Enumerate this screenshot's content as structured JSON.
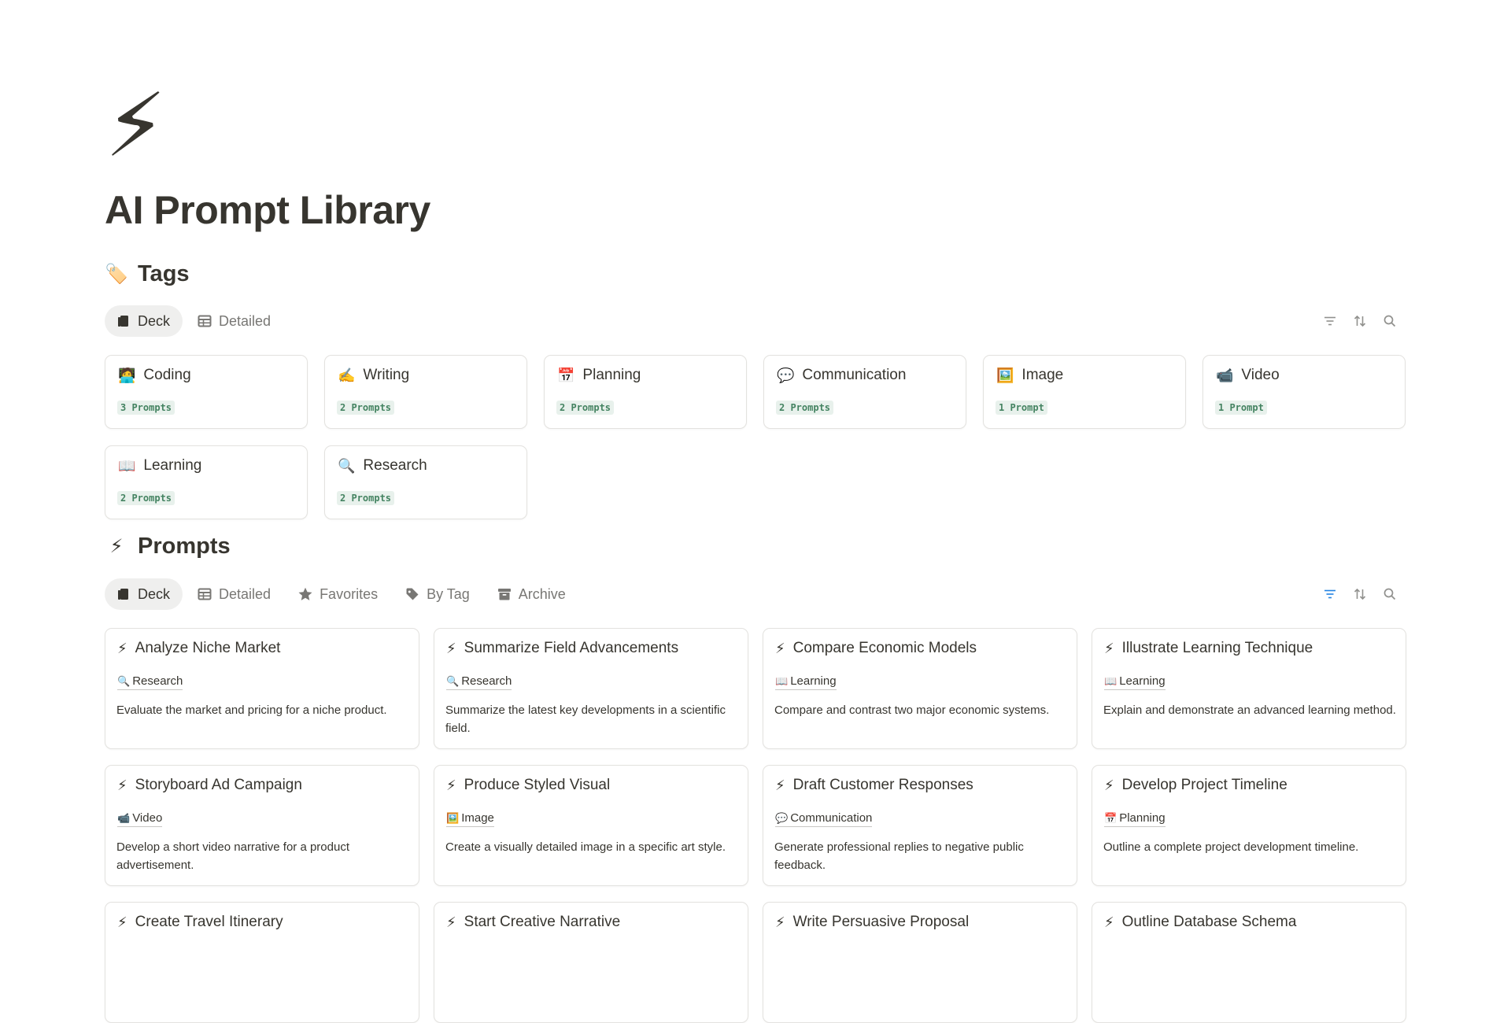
{
  "page": {
    "icon": "⚡",
    "title": "AI Prompt Library"
  },
  "tags_section": {
    "emoji": "🏷️",
    "title": "Tags",
    "views": [
      {
        "label": "Deck",
        "icon": "deck-icon",
        "active": true
      },
      {
        "label": "Detailed",
        "icon": "table-icon",
        "active": false
      }
    ],
    "cards": [
      {
        "emoji": "🧑‍💻",
        "name": "Coding",
        "count": "3 Prompts"
      },
      {
        "emoji": "✍️",
        "name": "Writing",
        "count": "2 Prompts"
      },
      {
        "emoji": "📅",
        "name": "Planning",
        "count": "2 Prompts"
      },
      {
        "emoji": "💬",
        "name": "Communication",
        "count": "2 Prompts"
      },
      {
        "emoji": "🖼️",
        "name": "Image",
        "count": "1 Prompt"
      },
      {
        "emoji": "📹",
        "name": "Video",
        "count": "1 Prompt"
      },
      {
        "emoji": "📖",
        "name": "Learning",
        "count": "2 Prompts"
      },
      {
        "emoji": "🔍",
        "name": "Research",
        "count": "2 Prompts"
      }
    ]
  },
  "prompts_section": {
    "emoji": "⚡",
    "title": "Prompts",
    "views": [
      {
        "label": "Deck",
        "icon": "deck-icon",
        "active": true
      },
      {
        "label": "Detailed",
        "icon": "table-icon",
        "active": false
      },
      {
        "label": "Favorites",
        "icon": "star-icon",
        "active": false
      },
      {
        "label": "By Tag",
        "icon": "tag-icon",
        "active": false
      },
      {
        "label": "Archive",
        "icon": "archive-icon",
        "active": false
      }
    ],
    "filter_active_color": "#2383e2",
    "cards": [
      {
        "emoji": "⚡",
        "name": "Analyze Niche Market",
        "tag_emoji": "🔍",
        "tag": "Research",
        "desc": "Evaluate the market and pricing for a niche product."
      },
      {
        "emoji": "⚡",
        "name": "Summarize Field Advancements",
        "tag_emoji": "🔍",
        "tag": "Research",
        "desc": "Summarize the latest key developments in a scientific field."
      },
      {
        "emoji": "⚡",
        "name": "Compare Economic Models",
        "tag_emoji": "📖",
        "tag": "Learning",
        "desc": "Compare and contrast two major economic systems."
      },
      {
        "emoji": "⚡",
        "name": "Illustrate Learning Technique",
        "tag_emoji": "📖",
        "tag": "Learning",
        "desc": "Explain and demonstrate an advanced learning method."
      },
      {
        "emoji": "⚡",
        "name": "Storyboard Ad Campaign",
        "tag_emoji": "📹",
        "tag": "Video",
        "desc": "Develop a short video narrative for a product advertisement."
      },
      {
        "emoji": "⚡",
        "name": "Produce Styled Visual",
        "tag_emoji": "🖼️",
        "tag": "Image",
        "desc": "Create a visually detailed image in a specific art style."
      },
      {
        "emoji": "⚡",
        "name": "Draft Customer Responses",
        "tag_emoji": "💬",
        "tag": "Communication",
        "desc": "Generate professional replies to negative public feedback."
      },
      {
        "emoji": "⚡",
        "name": "Develop Project Timeline",
        "tag_emoji": "📅",
        "tag": "Planning",
        "desc": "Outline a complete project development timeline."
      },
      {
        "emoji": "⚡",
        "name": "Create Travel Itinerary",
        "tag_emoji": "",
        "tag": "",
        "desc": ""
      },
      {
        "emoji": "⚡",
        "name": "Start Creative Narrative",
        "tag_emoji": "",
        "tag": "",
        "desc": ""
      },
      {
        "emoji": "⚡",
        "name": "Write Persuasive Proposal",
        "tag_emoji": "",
        "tag": "",
        "desc": ""
      },
      {
        "emoji": "⚡",
        "name": "Outline Database Schema",
        "tag_emoji": "",
        "tag": "",
        "desc": ""
      }
    ]
  }
}
